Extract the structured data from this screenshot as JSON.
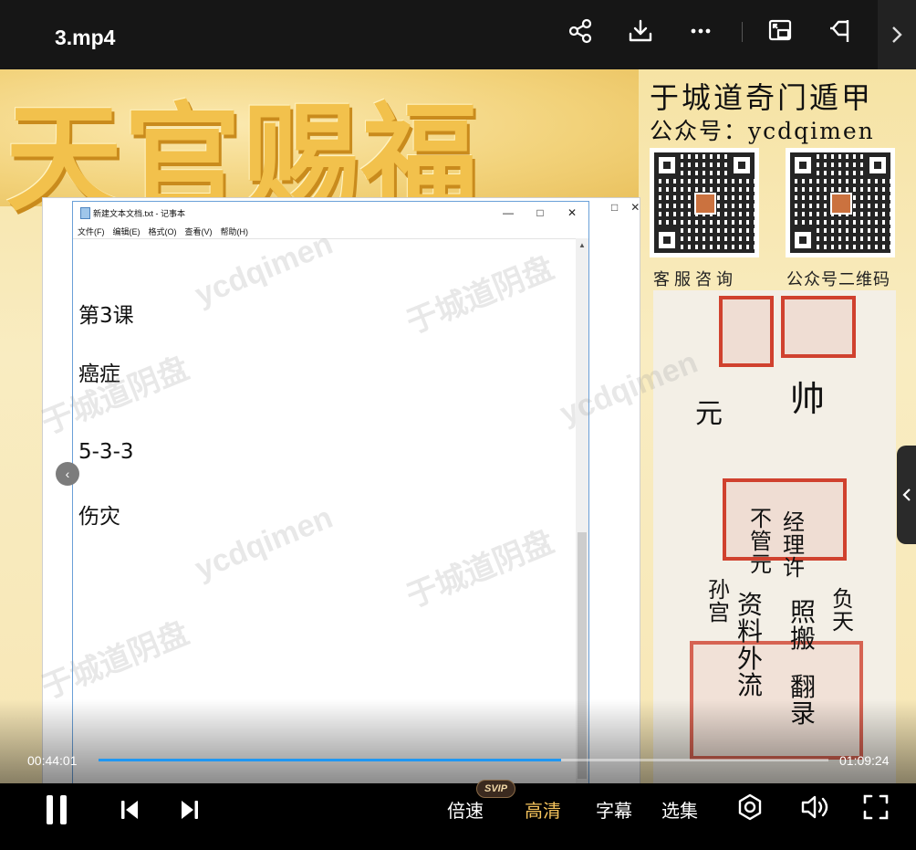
{
  "window": {
    "title": "3.mp4"
  },
  "top_actions": [
    {
      "name": "share",
      "icon": "share-icon"
    },
    {
      "name": "download",
      "icon": "download-icon"
    },
    {
      "name": "more",
      "icon": "more-icon"
    },
    {
      "name": "picture-in-picture",
      "icon": "pip-icon"
    },
    {
      "name": "float",
      "icon": "float-window-icon"
    }
  ],
  "video": {
    "banner_chars": "天官赐福",
    "brand_title": "于城道奇门遁甲",
    "brand_sub": "公众号：ycdqimen",
    "qr_captions": [
      "客服咨询",
      "公众号二维码"
    ],
    "watermark_cn": "于城道阴盘",
    "watermark_en": "ycdqimen",
    "cert_text": {
      "line1": "元",
      "line2": "帅",
      "col_a": "不管元",
      "col_b": "经理许",
      "col_c": "照搬",
      "col_d": "资料外流",
      "col_e": "孙宫",
      "col_f": "负天",
      "col_g": "翻录"
    },
    "notepad": {
      "title": "新建文本文档.txt - 记事本",
      "menu": [
        "文件(F)",
        "编辑(E)",
        "格式(O)",
        "查看(V)",
        "帮助(H)"
      ],
      "lines": [
        "第3课",
        "癌症",
        "5-3-3",
        "伤灾"
      ]
    }
  },
  "player": {
    "current_time": "00:44:01",
    "total_time": "01:09:24",
    "progress_fraction": 0.634,
    "speed_label": "倍速",
    "quality_label": "高清",
    "quality_badge": "SVIP",
    "subtitle_label": "字幕",
    "episodes_label": "选集",
    "accent_color": "#1f97f3",
    "hd_color": "#f5c35c"
  }
}
